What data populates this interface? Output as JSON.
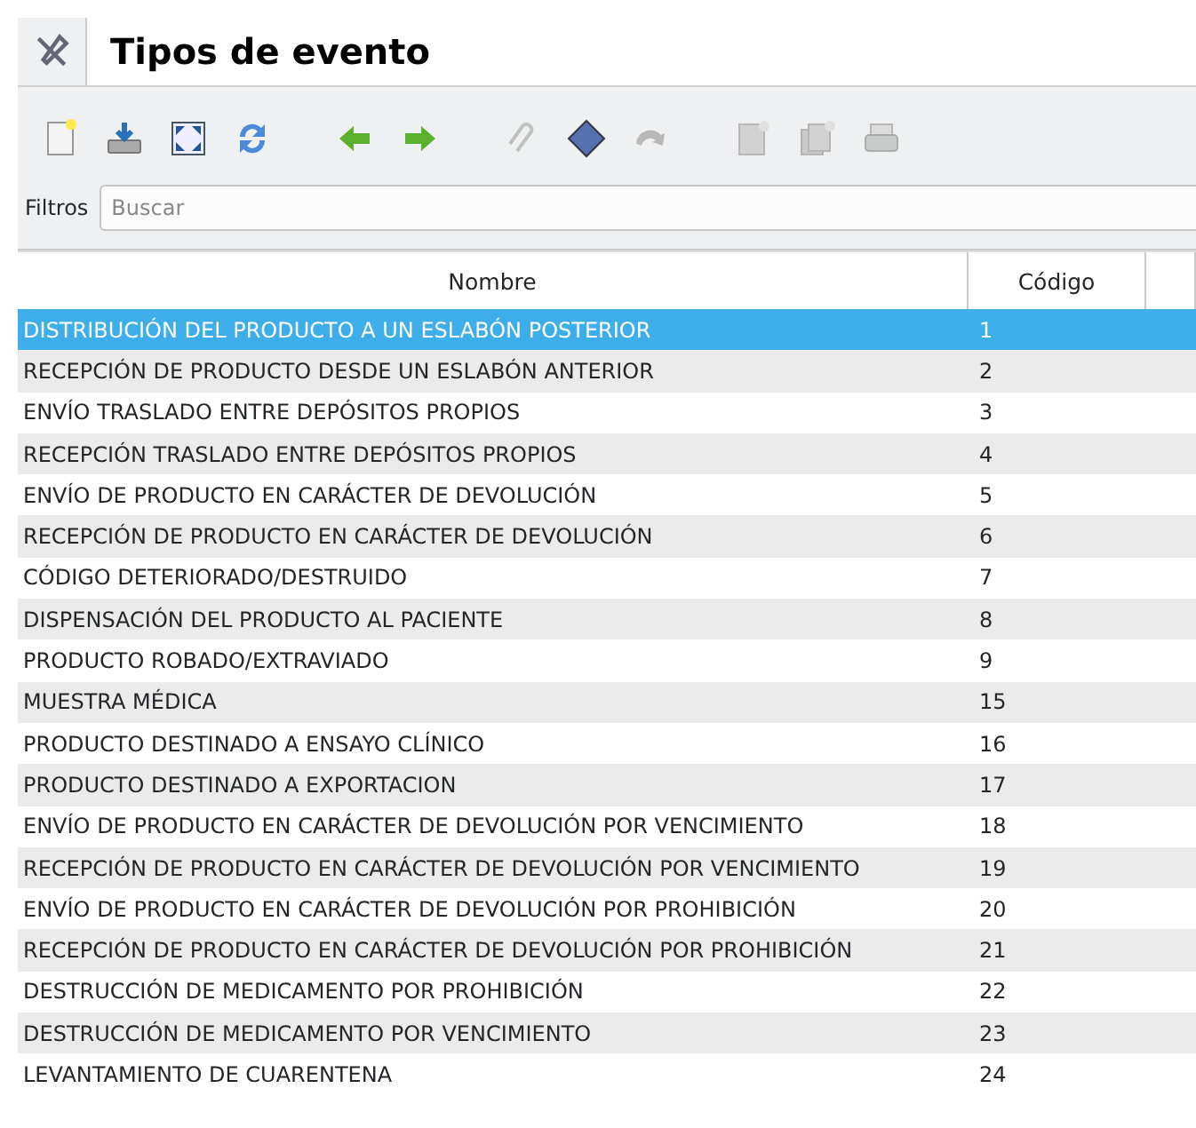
{
  "window": {
    "title": "Tipos de evento"
  },
  "toolbar": [
    {
      "kind": "new",
      "disabled": false
    },
    {
      "kind": "import",
      "disabled": false
    },
    {
      "kind": "expand",
      "disabled": false
    },
    {
      "kind": "refresh",
      "disabled": false
    },
    {
      "kind": "sep"
    },
    {
      "kind": "back",
      "disabled": false
    },
    {
      "kind": "forward",
      "disabled": false
    },
    {
      "kind": "sep"
    },
    {
      "kind": "attach",
      "disabled": true
    },
    {
      "kind": "diamond",
      "disabled": false
    },
    {
      "kind": "redo",
      "disabled": true
    },
    {
      "kind": "sep"
    },
    {
      "kind": "report",
      "disabled": true
    },
    {
      "kind": "reports",
      "disabled": true
    },
    {
      "kind": "print",
      "disabled": true
    }
  ],
  "filter": {
    "label": "Filtros",
    "placeholder": "Buscar"
  },
  "table": {
    "columns": [
      "Nombre",
      "Código"
    ],
    "rows": [
      {
        "cells": [
          "DISTRIBUCIÓN DEL PRODUCTO A UN ESLABÓN POSTERIOR",
          "1"
        ],
        "selected": true
      },
      {
        "cells": [
          "RECEPCIÓN DE PRODUCTO DESDE UN ESLABÓN ANTERIOR",
          "2"
        ],
        "selected": false
      },
      {
        "cells": [
          "ENVÍO TRASLADO ENTRE DEPÓSITOS PROPIOS",
          "3"
        ],
        "selected": false
      },
      {
        "cells": [
          "RECEPCIÓN TRASLADO ENTRE DEPÓSITOS PROPIOS",
          "4"
        ],
        "selected": false
      },
      {
        "cells": [
          "ENVÍO DE PRODUCTO EN CARÁCTER DE DEVOLUCIÓN",
          "5"
        ],
        "selected": false
      },
      {
        "cells": [
          "RECEPCIÓN DE PRODUCTO EN CARÁCTER DE DEVOLUCIÓN",
          "6"
        ],
        "selected": false
      },
      {
        "cells": [
          "CÓDIGO DETERIORADO/DESTRUIDO",
          "7"
        ],
        "selected": false
      },
      {
        "cells": [
          "DISPENSACIÓN DEL PRODUCTO AL PACIENTE",
          "8"
        ],
        "selected": false
      },
      {
        "cells": [
          "PRODUCTO ROBADO/EXTRAVIADO",
          "9"
        ],
        "selected": false
      },
      {
        "cells": [
          "MUESTRA MÉDICA",
          "15"
        ],
        "selected": false
      },
      {
        "cells": [
          "PRODUCTO DESTINADO A ENSAYO CLÍNICO",
          "16"
        ],
        "selected": false
      },
      {
        "cells": [
          "PRODUCTO DESTINADO A EXPORTACION",
          "17"
        ],
        "selected": false
      },
      {
        "cells": [
          "ENVÍO DE PRODUCTO EN CARÁCTER DE DEVOLUCIÓN POR VENCIMIENTO",
          "18"
        ],
        "selected": false
      },
      {
        "cells": [
          "RECEPCIÓN DE PRODUCTO EN CARÁCTER DE DEVOLUCIÓN POR VENCIMIENTO",
          "19"
        ],
        "selected": false
      },
      {
        "cells": [
          "ENVÍO DE PRODUCTO EN CARÁCTER DE DEVOLUCIÓN POR PROHIBICIÓN",
          "20"
        ],
        "selected": false
      },
      {
        "cells": [
          "RECEPCIÓN DE PRODUCTO EN CARÁCTER DE DEVOLUCIÓN POR PROHIBICIÓN",
          "21"
        ],
        "selected": false
      },
      {
        "cells": [
          "DESTRUCCIÓN DE MEDICAMENTO POR PROHIBICIÓN",
          "22"
        ],
        "selected": false
      },
      {
        "cells": [
          "DESTRUCCIÓN DE MEDICAMENTO POR VENCIMIENTO",
          "23"
        ],
        "selected": false
      },
      {
        "cells": [
          "LEVANTAMIENTO DE CUARENTENA",
          "24"
        ],
        "selected": false
      }
    ]
  }
}
